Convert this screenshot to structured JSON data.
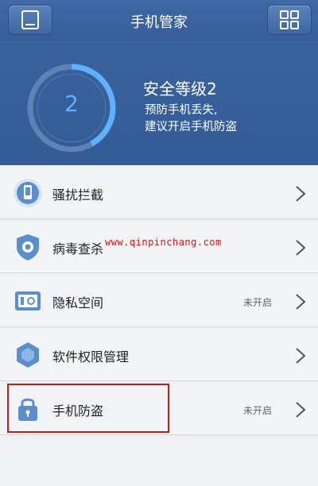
{
  "header": {
    "title": "手机管家",
    "left_icon": "phone-tablet-icon",
    "right_icon": "grid-menu-icon"
  },
  "security": {
    "level_number": "2",
    "title": "安全等级2",
    "line1": "预防手机丢失,",
    "line2": "建议开启手机防盗"
  },
  "menu": [
    {
      "label": "骚扰拦截",
      "state": "",
      "icon": "phone-block-icon"
    },
    {
      "label": "病毒查杀",
      "state": "",
      "icon": "shield-scan-icon"
    },
    {
      "label": "隐私空间",
      "state": "未开启",
      "icon": "safe-box-icon"
    },
    {
      "label": "软件权限管理",
      "state": "",
      "icon": "hexagon-permission-icon"
    },
    {
      "label": "手机防盗",
      "state": "未开启",
      "icon": "lock-icon"
    }
  ],
  "watermark": "www.qinpinchang.com",
  "colors": {
    "header": "#3a639d",
    "accent": "#5fb0ff",
    "highlight": "#c21d1d"
  }
}
